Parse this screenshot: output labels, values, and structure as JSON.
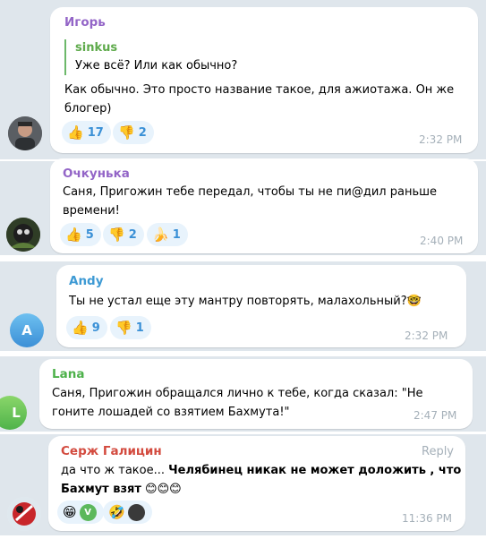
{
  "messages": [
    {
      "author": "Игорь",
      "author_color": "#9365c7",
      "quote": {
        "author": "sinkus",
        "text": "Уже всё? Или как обычно?"
      },
      "text_lines": [
        "Как обычно. Это просто название такое, для ажиотажа. Он же",
        "блогер)"
      ],
      "reactions": [
        {
          "emoji": "👍",
          "count": "17"
        },
        {
          "emoji": "👎",
          "count": "2"
        }
      ],
      "time": "2:32 PM"
    },
    {
      "author": "Очкунька",
      "author_color": "#9365c7",
      "text_lines": [
        "Саня, Пригожин тебе передал, чтобы ты не пи@дил раньше",
        "времени!"
      ],
      "reactions": [
        {
          "emoji": "👍",
          "count": "5"
        },
        {
          "emoji": "👎",
          "count": "2"
        },
        {
          "emoji": "🍌",
          "count": "1"
        }
      ],
      "time": "2:40 PM"
    },
    {
      "author": "Andy",
      "author_color": "#3e9ad4",
      "avatar_letter": "A",
      "text": "Ты не устал еще эту мантру повторять, малахольный?",
      "text_emoji": "🤓",
      "reactions": [
        {
          "emoji": "👍",
          "count": "9"
        },
        {
          "emoji": "👎",
          "count": "1"
        }
      ],
      "time": "2:32 PM"
    },
    {
      "author": "Lana",
      "author_color": "#4db14a",
      "avatar_letter": "L",
      "text_lines": [
        "Саня, Пригожин обращался лично к тебе, когда сказал: \"Не",
        "гоните лошадей со взятием Бахмута!\""
      ],
      "time": "2:47 PM"
    },
    {
      "author": "Серж Галицин",
      "author_color": "#d34b3f",
      "reply_label": "Reply",
      "text_prefix": "да что ж такое... ",
      "text_bold_1": "Челябинец никак не может доложить , что",
      "text_bold_2": "Бахмут взят",
      "text_emojis": "😊😊😊",
      "reactions": [
        {
          "emoji": "😁",
          "reactor_letter": "V"
        },
        {
          "emoji": "🤣",
          "reactor_letter": ""
        }
      ],
      "time": "11:36 PM"
    }
  ]
}
